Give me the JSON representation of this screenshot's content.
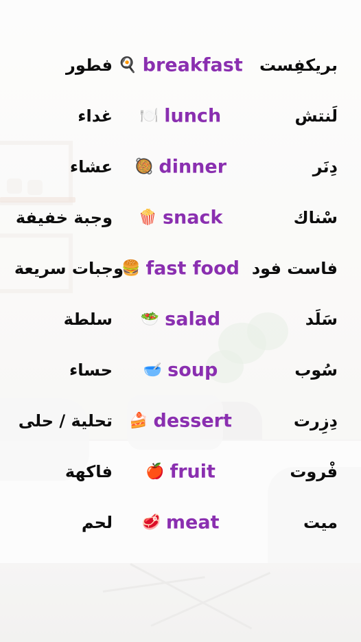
{
  "rows": [
    {
      "translit": "بريكفِست",
      "emoji": "🍳",
      "english": "breakfast",
      "arabic": "فطور"
    },
    {
      "translit": "لَنتش",
      "emoji": "🍽️",
      "english": "lunch",
      "arabic": "غداء"
    },
    {
      "translit": "دِنَر",
      "emoji": "🥘",
      "english": "dinner",
      "arabic": "عشاء"
    },
    {
      "translit": "سْناك",
      "emoji": "🍿",
      "english": "snack",
      "arabic": "وجبة خفيفة"
    },
    {
      "translit": "فاست فود",
      "emoji": "🍔",
      "english": "fast food",
      "arabic": "وجبات سريعة"
    },
    {
      "translit": "سَلَد",
      "emoji": "🥗",
      "english": "salad",
      "arabic": "سلطة"
    },
    {
      "translit": "سُوب",
      "emoji": "🥣",
      "english": "soup",
      "arabic": "حساء"
    },
    {
      "translit": "دِزِرت",
      "emoji": "🍰",
      "english": "dessert",
      "arabic": "تحلية / حلى"
    },
    {
      "translit": "فْروت",
      "emoji": "🍎",
      "english": "fruit",
      "arabic": "فاكهة"
    },
    {
      "translit": "ميت",
      "emoji": "🥩",
      "english": "meat",
      "arabic": "لحم"
    }
  ],
  "colors": {
    "english_text": "#8a2fb0",
    "arabic_text": "#0d0d0d"
  }
}
